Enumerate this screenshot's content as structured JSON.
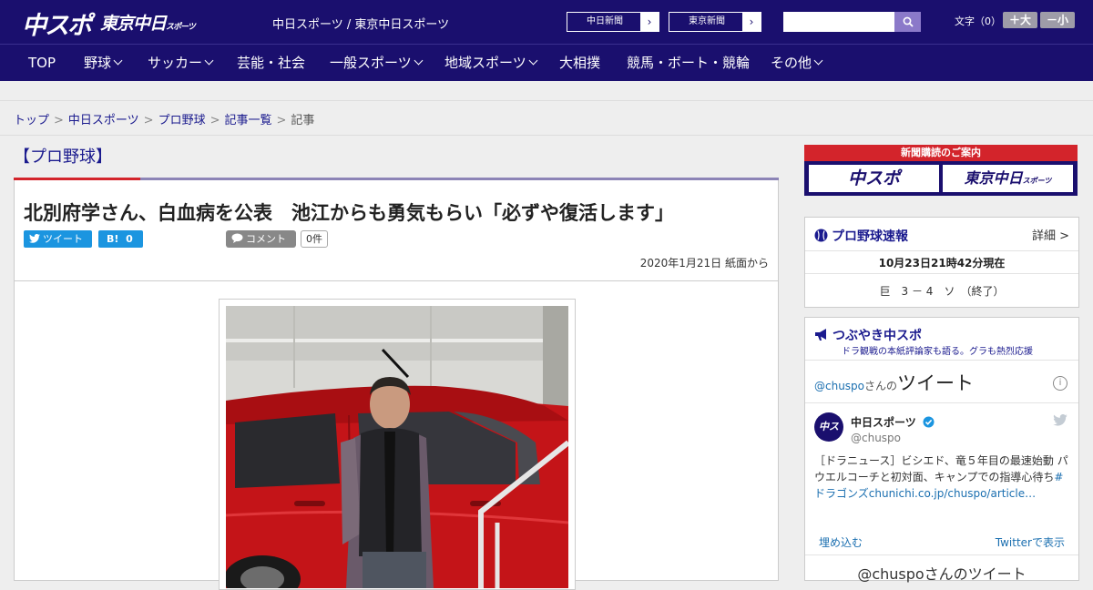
{
  "header": {
    "logo_main": "中スポ",
    "logo_tokyo": "東京中日",
    "logo_tokyo_small": "スポーツ",
    "site_title": "中日スポーツ / 東京中日スポーツ",
    "paper_links": [
      {
        "label": "中日新聞"
      },
      {
        "label": "東京新聞"
      }
    ],
    "fontsize_label": "文字（0）",
    "font_larger": "＋大",
    "font_smaller": "－小"
  },
  "nav": {
    "items": [
      {
        "label": "TOP",
        "dropdown": false
      },
      {
        "label": "野球",
        "dropdown": true
      },
      {
        "label": "サッカー",
        "dropdown": true
      },
      {
        "label": "芸能・社会",
        "dropdown": false
      },
      {
        "label": "一般スポーツ",
        "dropdown": true
      },
      {
        "label": "地域スポーツ",
        "dropdown": true
      },
      {
        "label": "大相撲",
        "dropdown": false
      },
      {
        "label": "競馬・ボート・競輪",
        "dropdown": false
      },
      {
        "label": "その他",
        "dropdown": true
      }
    ]
  },
  "breadcrumb": {
    "items": [
      "トップ",
      "中日スポーツ",
      "プロ野球",
      "記事一覧"
    ],
    "current": "記事",
    "separator": ">"
  },
  "article": {
    "category": "【プロ野球】",
    "headline": "北別府学さん、白血病を公表　池江からも勇気もらい「必ずや復活します」",
    "tweet_label": "ツイート",
    "hatena_label": "B!",
    "hatena_count": "0",
    "comment_label": "コメント",
    "comment_count": "0件",
    "date": "2020年1月21日 紙面から"
  },
  "sidebar": {
    "subscribe_title": "新聞購読のご案内",
    "subscribe_logo1": "中スポ",
    "subscribe_logo2": "東京中日",
    "subscribe_logo2_small": "スポーツ",
    "baseball": {
      "title": "プロ野球速報",
      "detail_link": "詳細 >",
      "updated": "10月23日21時42分現在",
      "game": "巨　3 － 4　ソ　（終了）"
    },
    "tweets": {
      "title": "つぶやき中スポ",
      "subtitle": "ドラ観戦の本紙評論家も語る。グラも熱烈応援",
      "handle_prefix": "@chuspo",
      "handle_suffix": "さんの",
      "tweet_word": "ツイート",
      "account_name": "中日スポーツ",
      "account_handle": "@chuspo",
      "tweet_text": "［ドラニュース］ビシエド、竜５年目の最速始動 パウエルコーチと初対面、キャンプでの指導心待ち",
      "tweet_link": "#ドラゴンズchunichi.co.jp/chuspo/article…",
      "embed_label": "埋め込む",
      "view_on_twitter": "Twitterで表示",
      "next_heading": "@chuspoさんのツイート"
    }
  },
  "colors": {
    "brand_navy": "#1a0f6e",
    "accent_red": "#d3242b",
    "twitter_blue": "#1b95e0"
  }
}
